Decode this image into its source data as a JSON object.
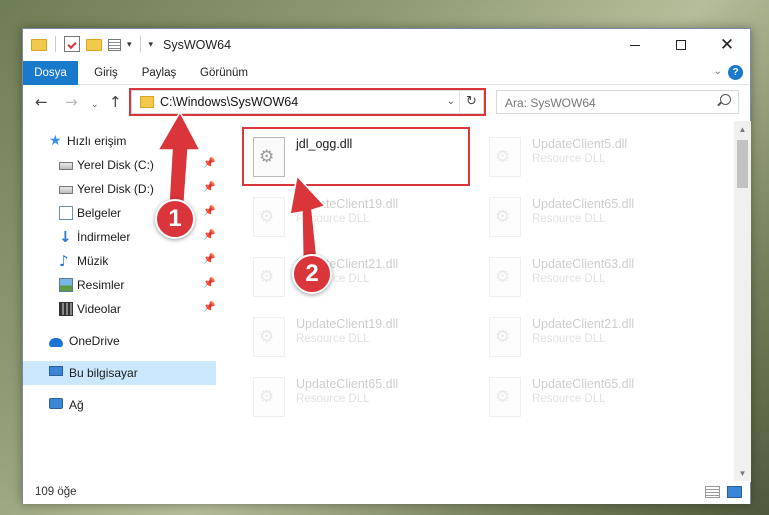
{
  "window": {
    "title": "SysWOW64"
  },
  "ribbon": {
    "tabs": [
      "Dosya",
      "Giriş",
      "Paylaş",
      "Görünüm"
    ],
    "help_label": "?"
  },
  "nav": {
    "address_path": "C:\\Windows\\SysWOW64",
    "search_placeholder": "Ara: SysWOW64"
  },
  "sidebar": {
    "items": [
      {
        "label": "Hızlı erişim",
        "icon": "star-icon",
        "pinned": false
      },
      {
        "label": "Yerel Disk (C:)",
        "icon": "drive-icon",
        "pinned": true
      },
      {
        "label": "Yerel Disk (D:)",
        "icon": "drive-icon",
        "pinned": true
      },
      {
        "label": "Belgeler",
        "icon": "documents-icon",
        "pinned": true
      },
      {
        "label": "İndirmeler",
        "icon": "downloads-icon",
        "pinned": true
      },
      {
        "label": "Müzik",
        "icon": "music-icon",
        "pinned": true
      },
      {
        "label": "Resimler",
        "icon": "pictures-icon",
        "pinned": true
      },
      {
        "label": "Videolar",
        "icon": "videos-icon",
        "pinned": true
      },
      {
        "label": "OneDrive",
        "icon": "onedrive-icon",
        "pinned": false
      },
      {
        "label": "Bu bilgisayar",
        "icon": "computer-icon",
        "pinned": false,
        "selected": true
      },
      {
        "label": "Ağ",
        "icon": "network-icon",
        "pinned": false
      }
    ]
  },
  "files": [
    {
      "name": "jdl_ogg.dll",
      "type": "",
      "highlighted": true
    },
    {
      "name": "UpdateClient5.dll",
      "type": "Resource DLL"
    },
    {
      "name": "UpdateClient19.dll",
      "type": "Resource DLL"
    },
    {
      "name": "UpdateClient65.dll",
      "type": "Resource DLL"
    },
    {
      "name": "UpdateClient21.dll",
      "type": "Resource DLL"
    },
    {
      "name": "UpdateClient63.dll",
      "type": "Resource DLL"
    },
    {
      "name": "UpdateClient19.dll",
      "type": "Resource DLL"
    },
    {
      "name": "UpdateClient21.dll",
      "type": "Resource DLL"
    },
    {
      "name": "UpdateClient65.dll",
      "type": "Resource DLL"
    },
    {
      "name": "UpdateClient65.dll",
      "type": "Resource DLL"
    }
  ],
  "status": {
    "item_count": "109 öğe"
  },
  "annotations": {
    "step1": "1",
    "step2": "2",
    "color": "#d9353a"
  }
}
